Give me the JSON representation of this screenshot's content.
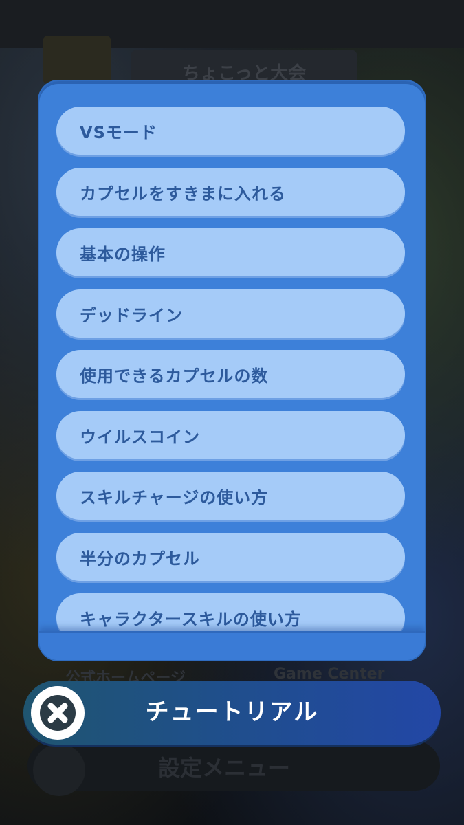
{
  "background": {
    "title_text": "ちょこっと大会",
    "bottom_left_link": "公式ホームページ",
    "bottom_right_link": "Game Center",
    "settings_title": "設定メニュー"
  },
  "tutorial": {
    "title": "チュートリアル",
    "close_icon": "close-icon",
    "items": [
      {
        "label": "VSモード"
      },
      {
        "label": "カプセルをすきまに入れる"
      },
      {
        "label": "基本の操作"
      },
      {
        "label": "デッドライン"
      },
      {
        "label": "使用できるカプセルの数"
      },
      {
        "label": "ウイルスコイン"
      },
      {
        "label": "スキルチャージの使い方"
      },
      {
        "label": "半分のカプセル"
      },
      {
        "label": "キャラクタースキルの使い方"
      }
    ]
  },
  "colors": {
    "panel": "#3d80d9",
    "item": "#a5cbf8",
    "item_text": "#2d5a9c",
    "banner": "#2347a6"
  }
}
